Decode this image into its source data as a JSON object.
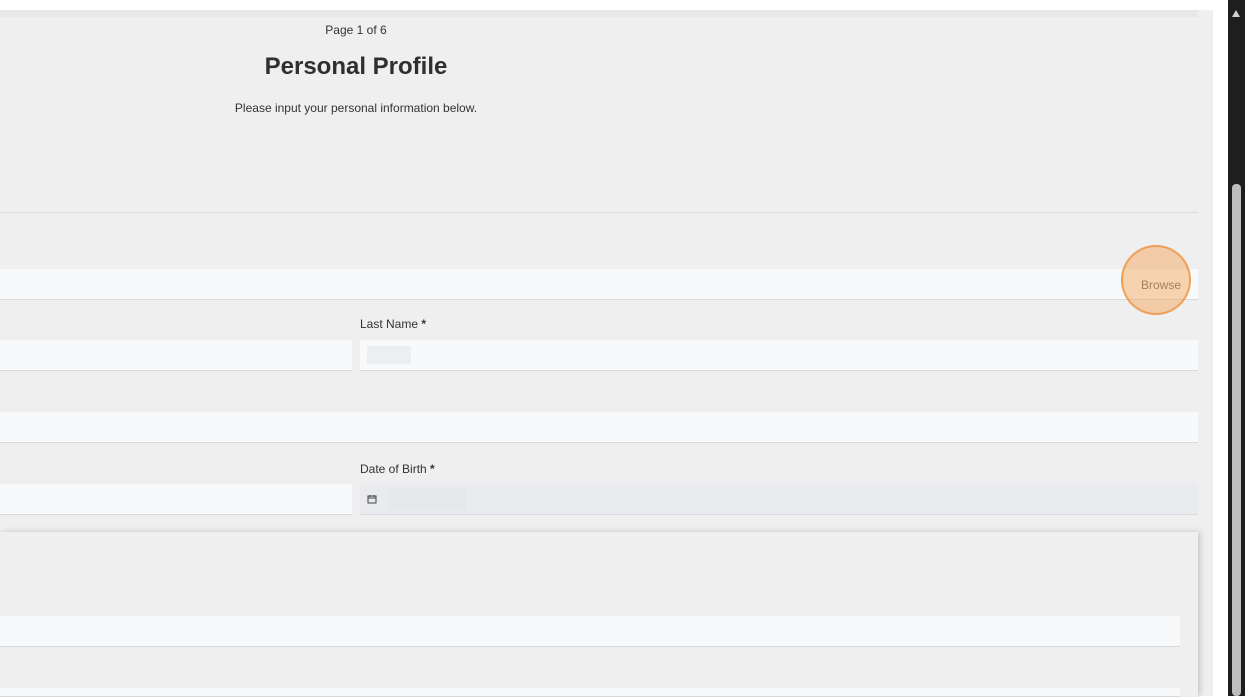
{
  "form": {
    "page_counter": "Page 1 of 6",
    "title": "Personal Profile",
    "subtitle": "Please input your personal information below.",
    "browse_label": "Browse",
    "last_name_label": "Last Name",
    "date_of_birth_label": "Date of Birth",
    "required_marker": "*"
  },
  "icons": {
    "calendar": "calendar-icon",
    "scroll_up": "scroll-up-arrow-icon"
  },
  "colors": {
    "highlight": "#f5a150",
    "page_background": "#efefef",
    "field_background": "#f8f9fb"
  }
}
